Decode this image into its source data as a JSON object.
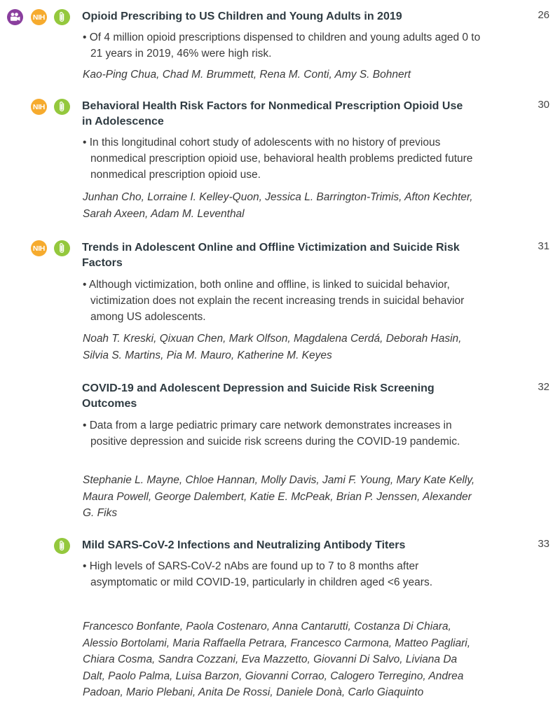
{
  "articles": [
    {
      "title": "Opioid Prescribing to US Children and Young Adults in 2019",
      "page": "26",
      "icons": [
        "video-icon",
        "nih-badge",
        "paperclip-icon"
      ],
      "nih_label": "NIH",
      "summary": "• Of 4 million opioid prescriptions dispensed to children and young adults aged 0 to 21 years in 2019, 46% were high risk.",
      "authors": "Kao-Ping Chua, Chad M. Brummett, Rena M. Conti, Amy S. Bohnert"
    },
    {
      "title": "Behavioral Health Risk Factors for Nonmedical Prescription Opioid Use in Adolescence",
      "page": "30",
      "icons": [
        "nih-badge",
        "paperclip-icon"
      ],
      "nih_label": "NIH",
      "summary": "• In this longitudinal cohort study of adolescents with no history of previous nonmedical prescription opioid use, behavioral health problems predicted future nonmedical prescription opioid use.",
      "authors": "Junhan Cho, Lorraine I. Kelley-Quon, Jessica L. Barrington-Trimis, Afton Kechter, Sarah Axeen, Adam M. Leventhal"
    },
    {
      "title": "Trends in Adolescent Online and Offline Victimization and Suicide Risk Factors",
      "page": "31",
      "icons": [
        "nih-badge",
        "paperclip-icon"
      ],
      "nih_label": "NIH",
      "summary": "• Although victimization, both online and offline, is linked to suicidal behavior, victimization does not explain the recent increasing trends in suicidal behavior among US adolescents.",
      "authors": "Noah T. Kreski, Qixuan Chen, Mark Olfson, Magdalena Cerdá, Deborah Hasin, Silvia S. Martins, Pia M. Mauro, Katherine M. Keyes"
    },
    {
      "title": "COVID-19 and Adolescent Depression and Suicide Risk Screening Outcomes",
      "page": "32",
      "icons": [],
      "summary": "• Data from a large pediatric primary care network demonstrates increases in positive depression and suicide risk screens during the COVID-19 pandemic.",
      "authors": "Stephanie L. Mayne, Chloe Hannan, Molly Davis, Jami F. Young, Mary Kate Kelly, Maura Powell, George Dalembert, Katie E. McPeak, Brian P. Jenssen, Alexander G. Fiks"
    },
    {
      "title": "Mild SARS-CoV-2 Infections and Neutralizing Antibody Titers",
      "page": "33",
      "icons": [
        "paperclip-icon"
      ],
      "summary": "• High levels of SARS-CoV-2 nAbs are found up to 7 to 8 months after asymptomatic or mild COVID-19, particularly in children aged <6 years.",
      "authors": "Francesco Bonfante, Paola Costenaro, Anna Cantarutti, Costanza Di Chiara, Alessio Bortolami, Maria Raffaella Petrara, Francesco Carmona, Matteo Pagliari, Chiara Cosma, Sandra Cozzani, Eva Mazzetto, Giovanni Di Salvo, Liviana Da Dalt, Paolo Palma, Luisa Barzon, Giovanni Corrao, Calogero Terregino, Andrea Padoan, Mario Plebani, Anita De Rossi, Daniele Donà, Carlo Giaquinto"
    }
  ],
  "colors": {
    "video_icon": "#8a3f9e",
    "nih_badge": "#f6ab2e",
    "paperclip_icon": "#94c83d",
    "title_text": "#2f3b42"
  }
}
